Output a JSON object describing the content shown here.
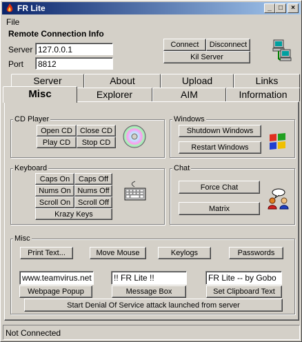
{
  "window": {
    "title": "FR Lite",
    "controls": [
      "_",
      "□",
      "×"
    ]
  },
  "menu": {
    "file": "File"
  },
  "connection": {
    "title": "Remote Connection Info",
    "server_label": "Server",
    "server_value": "127.0.0.1",
    "port_label": "Port",
    "port_value": "8812",
    "connect": "Connect",
    "disconnect": "Disconnect",
    "kill_server": "Kil Server"
  },
  "tabs_back": [
    "Server",
    "About",
    "Upload",
    "Links"
  ],
  "tabs_front": [
    "Misc",
    "Explorer",
    "AIM",
    "Information"
  ],
  "cd_player": {
    "title": "CD Player",
    "open_cd": "Open CD",
    "close_cd": "Close CD",
    "play_cd": "Play CD",
    "stop_cd": "Stop CD"
  },
  "windows_group": {
    "title": "Windows",
    "shutdown": "Shutdown Windows",
    "restart": "Restart Windows"
  },
  "keyboard": {
    "title": "Keyboard",
    "caps_on": "Caps On",
    "caps_off": "Caps Off",
    "nums_on": "Nums On",
    "nums_off": "Nums Off",
    "scroll_on": "Scroll On",
    "scroll_off": "Scroll Off",
    "krazy_keys": "Krazy Keys"
  },
  "chat": {
    "title": "Chat",
    "force_chat": "Force Chat",
    "matrix": "Matrix"
  },
  "misc": {
    "title": "Misc",
    "print_text": "Print Text...",
    "move_mouse": "Move Mouse",
    "keylogs": "Keylogs",
    "passwords": "Passwords",
    "url_value": "www.teamvirus.net",
    "message_value": "!! FR Lite !!",
    "clipboard_value": "FR Lite -- by Gobo",
    "webpage_popup": "Webpage Popup",
    "message_box": "Message Box",
    "set_clipboard": "Set Clipboard Text",
    "dos_attack": "Start Denial Of Service attack launched from server"
  },
  "status": {
    "text": "Not Connected"
  },
  "icons": {
    "app": "app-fire-icon",
    "network": "network-computers-icon",
    "cd": "cd-disc-icon",
    "windows": "windows-flag-icon",
    "keyboard": "keyboard-icon",
    "chat": "chat-people-icon"
  }
}
